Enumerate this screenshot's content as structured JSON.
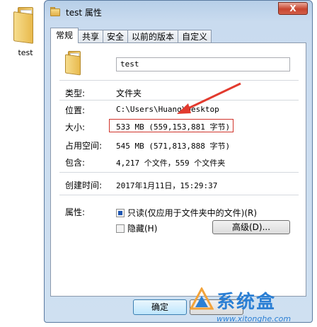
{
  "desktop": {
    "icon_label": "test"
  },
  "window": {
    "title": "test 属性",
    "close_glyph": "X"
  },
  "tabs": [
    {
      "label": "常规",
      "active": true
    },
    {
      "label": "共享",
      "active": false
    },
    {
      "label": "安全",
      "active": false
    },
    {
      "label": "以前的版本",
      "active": false
    },
    {
      "label": "自定义",
      "active": false
    }
  ],
  "general": {
    "name_value": "test",
    "rows": {
      "type": {
        "label": "类型:",
        "value": "文件夹"
      },
      "location": {
        "label": "位置:",
        "value": "C:\\Users\\Huang\\Desktop"
      },
      "size": {
        "label": "大小:",
        "value": "533 MB (559,153,881 字节)"
      },
      "size_on_disk": {
        "label": "占用空间:",
        "value": "545 MB (571,813,888 字节)"
      },
      "contains": {
        "label": "包含:",
        "value": "4,217 个文件，559 个文件夹"
      },
      "created": {
        "label": "创建时间:",
        "value": "2017年1月11日，15:29:37"
      },
      "attributes": {
        "label": "属性:"
      }
    },
    "attr_readonly": {
      "label": "只读(仅应用于文件夹中的文件)(R)",
      "checked": true
    },
    "attr_hidden": {
      "label": "隐藏(H)",
      "checked": false
    },
    "advanced_button": "高级(D)..."
  },
  "footer": {
    "ok_label": "确定"
  },
  "watermark": {
    "brand": "系统盒",
    "url": "www.xitonghe.com"
  },
  "colors": {
    "highlight_box": "#d0342b",
    "arrow": "#e23a2e",
    "watermark": "#2b7fd4"
  }
}
